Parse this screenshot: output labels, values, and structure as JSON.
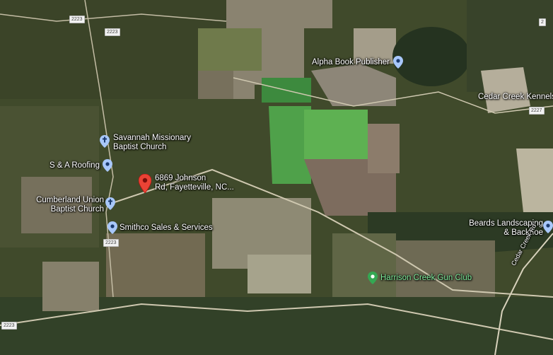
{
  "map": {
    "view": "satellite",
    "places": [
      {
        "id": "alpha-book-publisher",
        "name": "Alpha Book Publisher",
        "icon": "location-pin-icon",
        "color": "#a8c7fa"
      },
      {
        "id": "cedar-creek-kennels",
        "name": "Cedar Creek Kennels",
        "icon": "none"
      },
      {
        "id": "savannah-missionary",
        "name_line1": "Savannah Missionary",
        "name_line2": "Baptist Church",
        "icon": "church-cross-icon",
        "color": "#a8c7fa"
      },
      {
        "id": "s-a-roofing",
        "name": "S & A Roofing",
        "icon": "location-pin-icon",
        "color": "#a8c7fa"
      },
      {
        "id": "address",
        "name_line1": "6869 Johnson",
        "name_line2": "Rd, Fayetteville, NC...",
        "icon": "red-marker-icon",
        "color": "#ea4335"
      },
      {
        "id": "cumberland-union",
        "name_line1": "Cumberland Union",
        "name_line2": "Baptist Church",
        "icon": "church-cross-icon",
        "color": "#a8c7fa"
      },
      {
        "id": "smithco",
        "name": "Smithco Sales & Services",
        "icon": "location-pin-icon",
        "color": "#a8c7fa"
      },
      {
        "id": "beards-landscaping",
        "name_line1": "Beards Landscaping",
        "name_line2": "& Backhoe",
        "icon": "location-pin-icon",
        "color": "#a8c7fa"
      },
      {
        "id": "harrison-creek",
        "name": "Harrison Creek Gun Club",
        "icon": "park-pin-icon",
        "color": "#34a853"
      }
    ],
    "roads": {
      "shield_2223_a": "2223",
      "shield_2223_b": "2223",
      "shield_2223_c": "2223",
      "shield_2223_d": "2223",
      "shield_2227": "2227",
      "shield_top_right": "2",
      "road_label": "Cedar Creek Rd"
    }
  }
}
